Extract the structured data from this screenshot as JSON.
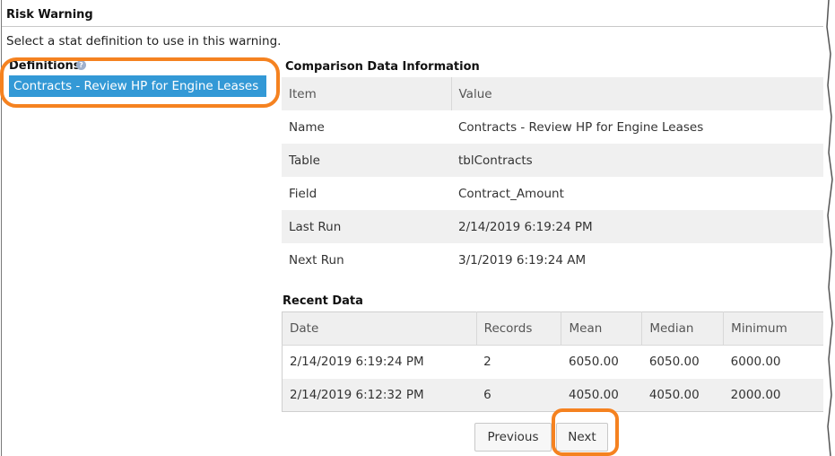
{
  "window": {
    "title": "Risk Warning"
  },
  "instruction": "Select a stat definition to use in this warning.",
  "definitions": {
    "label": "Definitions",
    "help_icon": "help-icon",
    "selected_item": "Contracts - Review HP for Engine Leases"
  },
  "comparison": {
    "title": "Comparison Data Information",
    "headers": [
      "Item",
      "Value"
    ],
    "rows": [
      {
        "item": "Name",
        "value": "Contracts - Review HP for Engine Leases"
      },
      {
        "item": "Table",
        "value": "tblContracts"
      },
      {
        "item": "Field",
        "value": "Contract_Amount"
      },
      {
        "item": "Last Run",
        "value": "2/14/2019 6:19:24 PM"
      },
      {
        "item": "Next Run",
        "value": "3/1/2019 6:19:24 AM"
      }
    ]
  },
  "recent": {
    "title": "Recent Data",
    "headers": [
      "Date",
      "Records",
      "Mean",
      "Median",
      "Minimum"
    ],
    "rows": [
      {
        "date": "2/14/2019 6:19:24 PM",
        "records": "2",
        "mean": "6050.00",
        "median": "6050.00",
        "minimum": "6000.00"
      },
      {
        "date": "2/14/2019 6:12:32 PM",
        "records": "6",
        "mean": "4050.00",
        "median": "4050.00",
        "minimum": "2000.00"
      }
    ]
  },
  "buttons": {
    "previous": "Previous",
    "next": "Next"
  },
  "colors": {
    "highlight": "#f58220",
    "selection": "#3399d6"
  }
}
